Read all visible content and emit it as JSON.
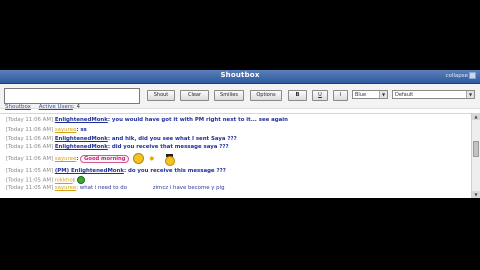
{
  "shoutbox": {
    "title": "Shoutbox",
    "collapse_label": "collapse"
  },
  "toolbar": {
    "message_value": "",
    "shout_label": "Shout",
    "clear_label": "Clear",
    "smilies_label": "Smilies",
    "options_label": "Options",
    "bold_label": "B",
    "underline_label": "U",
    "italic_label": "I",
    "color_value": "Blue",
    "font_value": "Default"
  },
  "tabs": {
    "shoutbox_label": "Shoutbox",
    "active_users_label": "Active Users",
    "active_users_count": "4"
  },
  "messages": [
    {
      "time": "[Today 11:06 AM]",
      "user": "EnlightenedMonk",
      "text": ": you would have got it with PM right next to it... see again",
      "style": "bold"
    },
    {
      "time": "[Today 11:06 AM]",
      "user": "sayuree",
      "text": ": ss",
      "style": "bold"
    },
    {
      "time": "[Today 11:06 AM]",
      "user": "EnlightenedMonk",
      "text": ": and hik, did you see what I sent Saya ???",
      "style": "bold"
    },
    {
      "time": "[Today 11:06 AM]",
      "user": "EnlightenedMonk",
      "text": ": did you receive that message saya ???",
      "style": "bold"
    },
    {
      "time": "[Today 11:06 AM]",
      "user": "sayuree",
      "text": ":",
      "style": "bold",
      "bubble": "Good morning"
    },
    {
      "time": "[Today 11:05 AM]",
      "user": "(PM) EnlightenedMonk",
      "text": ": do you receive this message ???",
      "style": "bold"
    },
    {
      "time": "[Today 11:05 AM]",
      "user": "nikkho",
      "text": ":",
      "style": "bold"
    },
    {
      "time": "[Today 11:05 AM]",
      "user": "sayuree",
      "text": ": what i need to do",
      "style": "plain",
      "extra": "zimcz i have become y pig"
    }
  ],
  "colors": {
    "header": "#2f5aa0",
    "message_text": "#1f2f9a",
    "user_link": "#d4a017",
    "link_blue": "#2b4c9c",
    "background": "#000000"
  },
  "icons": {
    "emoticon_1": "cool-smiley-icon",
    "emoticon_2": "sparkle-icon",
    "emoticon_3": "hat-smiley-icon",
    "emoticon_4": "green-emoticon-icon"
  }
}
